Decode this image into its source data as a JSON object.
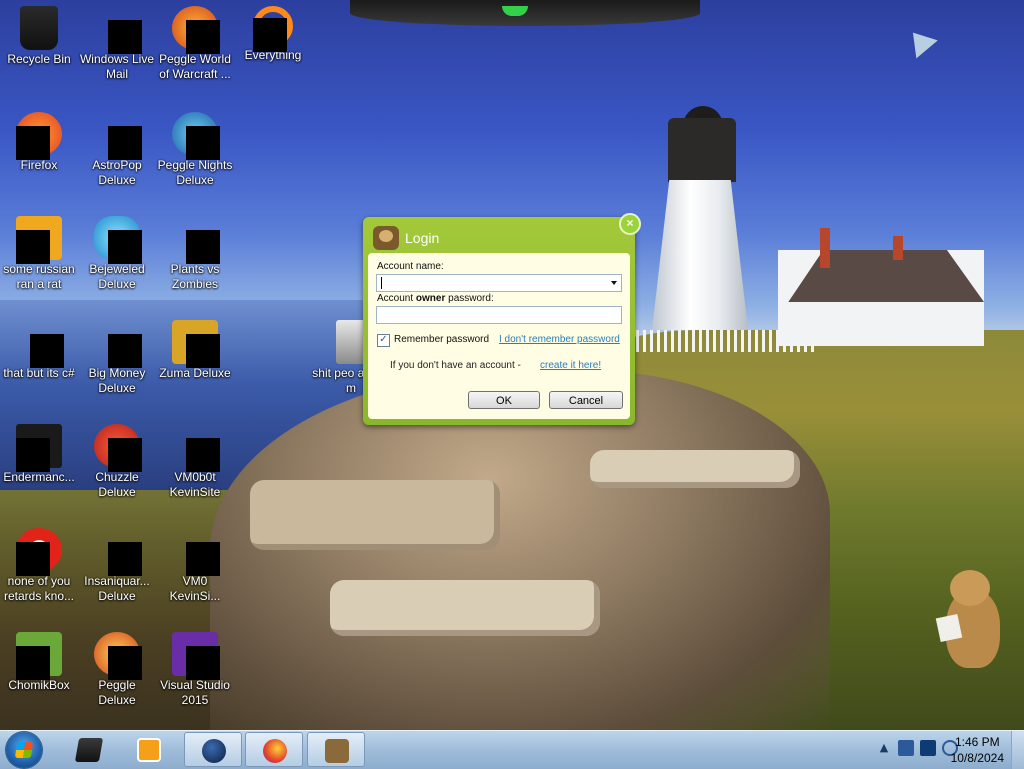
{
  "desktop": {
    "icons": [
      {
        "label": "Recycle Bin",
        "icon": "recycle-bin-icon"
      },
      {
        "label": "Windows Live Mail",
        "icon": "mail-icon"
      },
      {
        "label": "Peggle World of Warcraft ...",
        "icon": "game-icon"
      },
      {
        "label": "Everything",
        "icon": "search-icon"
      },
      {
        "label": "Firefox",
        "icon": "firefox-icon"
      },
      {
        "label": "AstroPop Deluxe",
        "icon": "game-icon"
      },
      {
        "label": "Peggle Nights Deluxe",
        "icon": "game-icon"
      },
      {
        "label": "some russian ran a rat",
        "icon": "app-icon"
      },
      {
        "label": "Bejeweled Deluxe",
        "icon": "game-icon"
      },
      {
        "label": "Plants vs Zombies",
        "icon": "game-icon"
      },
      {
        "label": "that but its c#",
        "icon": "app-icon"
      },
      {
        "label": "Big Money Deluxe",
        "icon": "game-icon"
      },
      {
        "label": "Zuma Deluxe",
        "icon": "game-icon"
      },
      {
        "label": "shit peo asked m",
        "icon": "folder-icon"
      },
      {
        "label": "Endermanc...",
        "icon": "app-icon"
      },
      {
        "label": "Chuzzle Deluxe",
        "icon": "game-icon"
      },
      {
        "label": "VM0b0t KevinSite",
        "icon": "app-icon"
      },
      {
        "label": "none of you retards kno...",
        "icon": "browser-icon"
      },
      {
        "label": "Insaniquar... Deluxe",
        "icon": "game-icon"
      },
      {
        "label": "VM0 KevinSi...",
        "icon": "app-icon"
      },
      {
        "label": "ChomikBox",
        "icon": "chomikbox-icon"
      },
      {
        "label": "Peggle Deluxe",
        "icon": "game-icon"
      },
      {
        "label": "Visual Studio 2015",
        "icon": "visual-studio-icon"
      }
    ]
  },
  "dialog": {
    "title": "Login",
    "account_name_label": "Account name:",
    "account_name_value": "",
    "password_label_prefix": "Account ",
    "password_label_bold": "owner",
    "password_label_suffix": " password:",
    "password_value": "",
    "remember_label": "Remember password",
    "remember_checked": "✓",
    "forgot_link": "I don't remember password",
    "no_account_text": "If you don't have an account - ",
    "create_link": "create it here!",
    "ok_label": "OK",
    "cancel_label": "Cancel",
    "close_glyph": "×"
  },
  "taskbar": {
    "clock_time": "1:46 PM",
    "clock_date": "10/8/2024",
    "tray_expand_glyph": "▲",
    "pinned": [
      "file-explorer-icon",
      "media-player-icon",
      "globe-icon",
      "firefox-icon",
      "chomikbox-icon"
    ]
  },
  "colors": {
    "dialog_accent": "#8ab82b",
    "link": "#2a7fb8"
  }
}
